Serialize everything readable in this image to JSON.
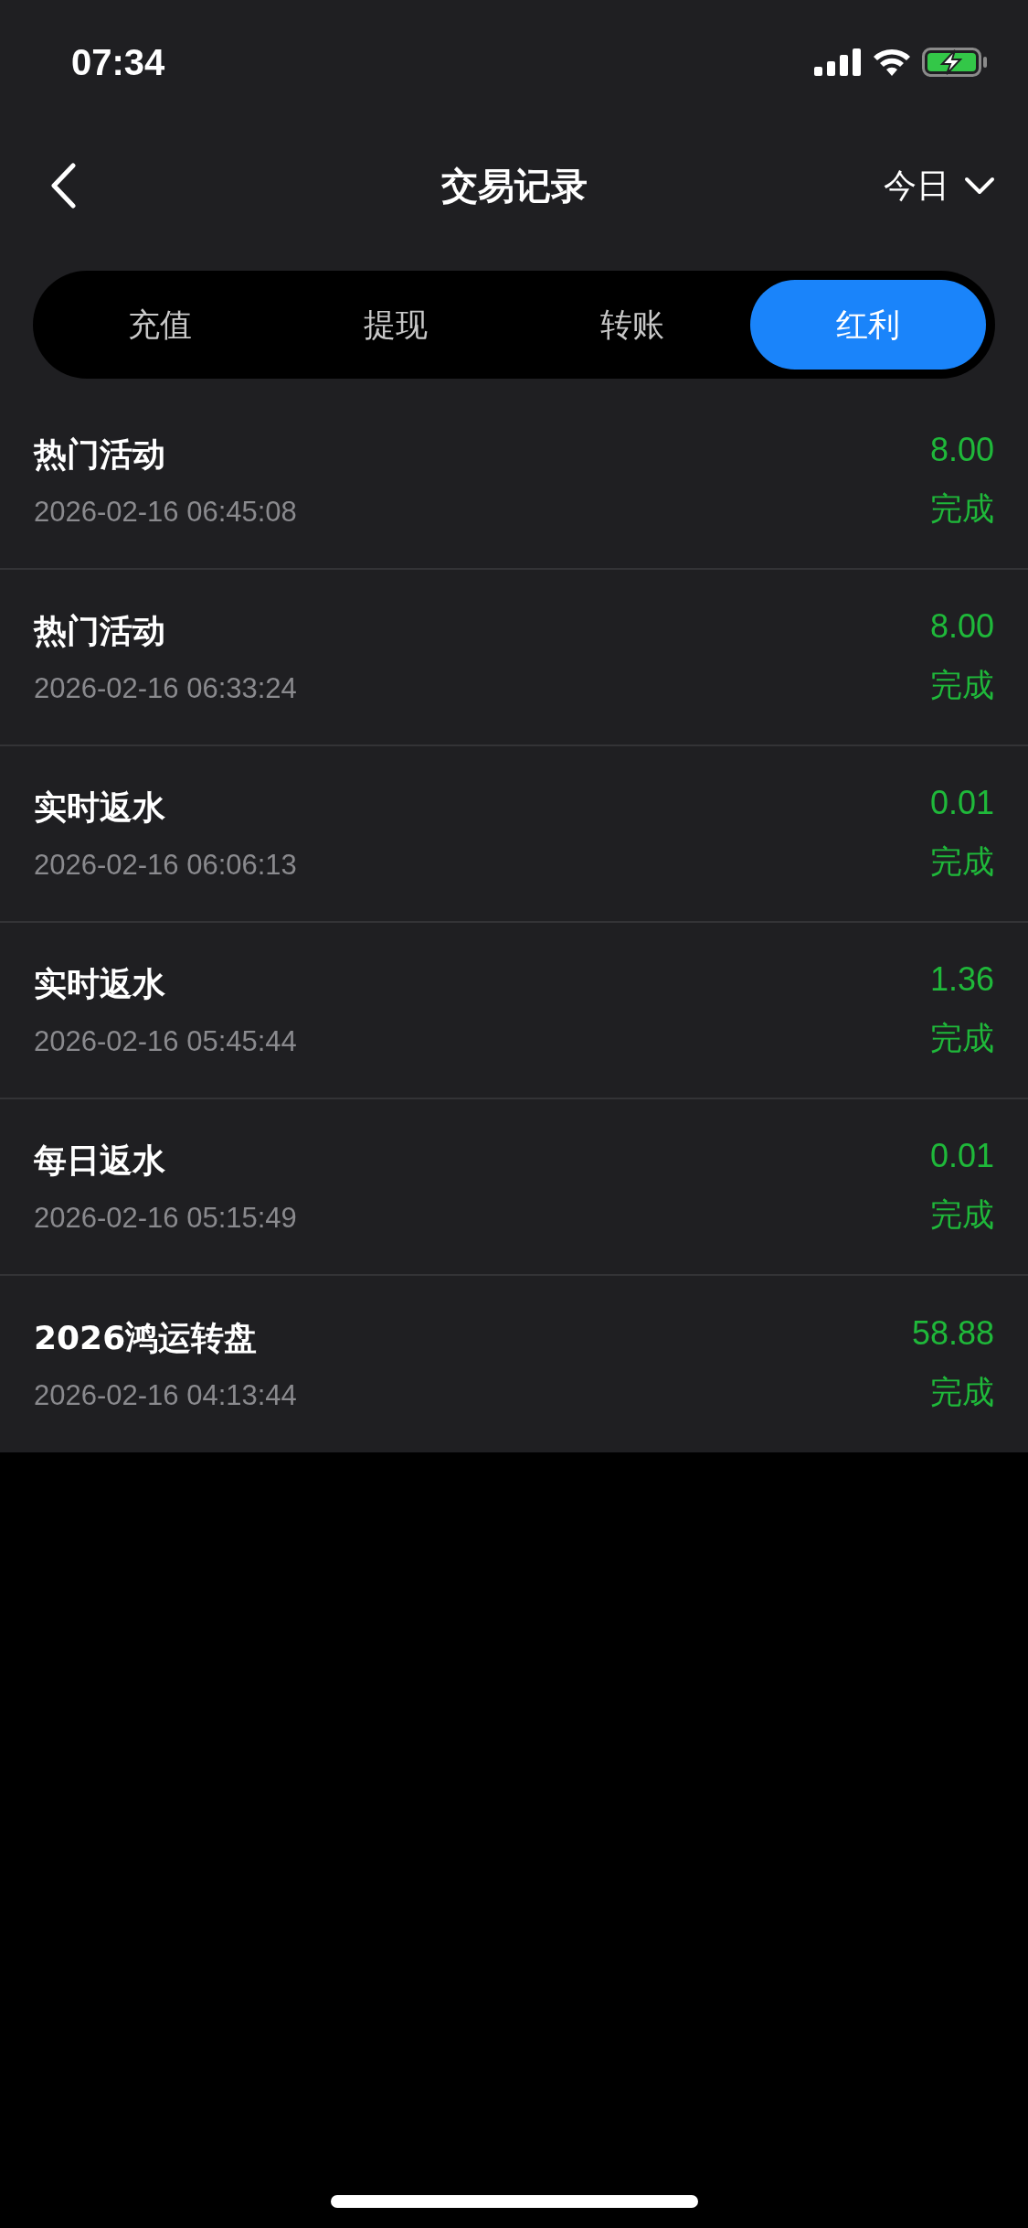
{
  "status_bar": {
    "time": "07:34",
    "battery_charging": true
  },
  "nav": {
    "title": "交易记录",
    "filter": "今日"
  },
  "tabs": [
    {
      "label": "充值",
      "selected": false
    },
    {
      "label": "提现",
      "selected": false
    },
    {
      "label": "转账",
      "selected": false
    },
    {
      "label": "红利",
      "selected": true
    }
  ],
  "records": [
    {
      "name": "热门活动",
      "time": "2026-02-16 06:45:08",
      "amount": "8.00",
      "status": "完成"
    },
    {
      "name": "热门活动",
      "time": "2026-02-16 06:33:24",
      "amount": "8.00",
      "status": "完成"
    },
    {
      "name": "实时返水",
      "time": "2026-02-16 06:06:13",
      "amount": "0.01",
      "status": "完成"
    },
    {
      "name": "实时返水",
      "time": "2026-02-16 05:45:44",
      "amount": "1.36",
      "status": "完成"
    },
    {
      "name": "每日返水",
      "time": "2026-02-16 05:15:49",
      "amount": "0.01",
      "status": "完成"
    },
    {
      "name": "2026鸿运转盘",
      "time": "2026-02-16 04:13:44",
      "amount": "58.88",
      "status": "完成"
    }
  ]
}
